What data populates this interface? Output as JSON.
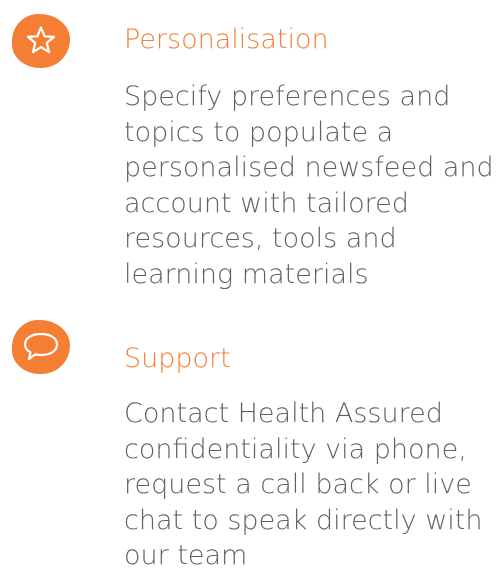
{
  "colors": {
    "accent": "#F47F34",
    "text": "#606060",
    "icon_stroke": "#FFFFFF"
  },
  "features": [
    {
      "icon": "star-icon",
      "title": "Personalisation",
      "description": "Specify preferences and topics to populate a personalised newsfeed and account with tailored resources, tools and learning materials"
    },
    {
      "icon": "speech-bubble-icon",
      "title": "Support",
      "description": "Contact Health Assured confidentiality via phone, request a call back or live chat to speak directly with our team"
    }
  ]
}
